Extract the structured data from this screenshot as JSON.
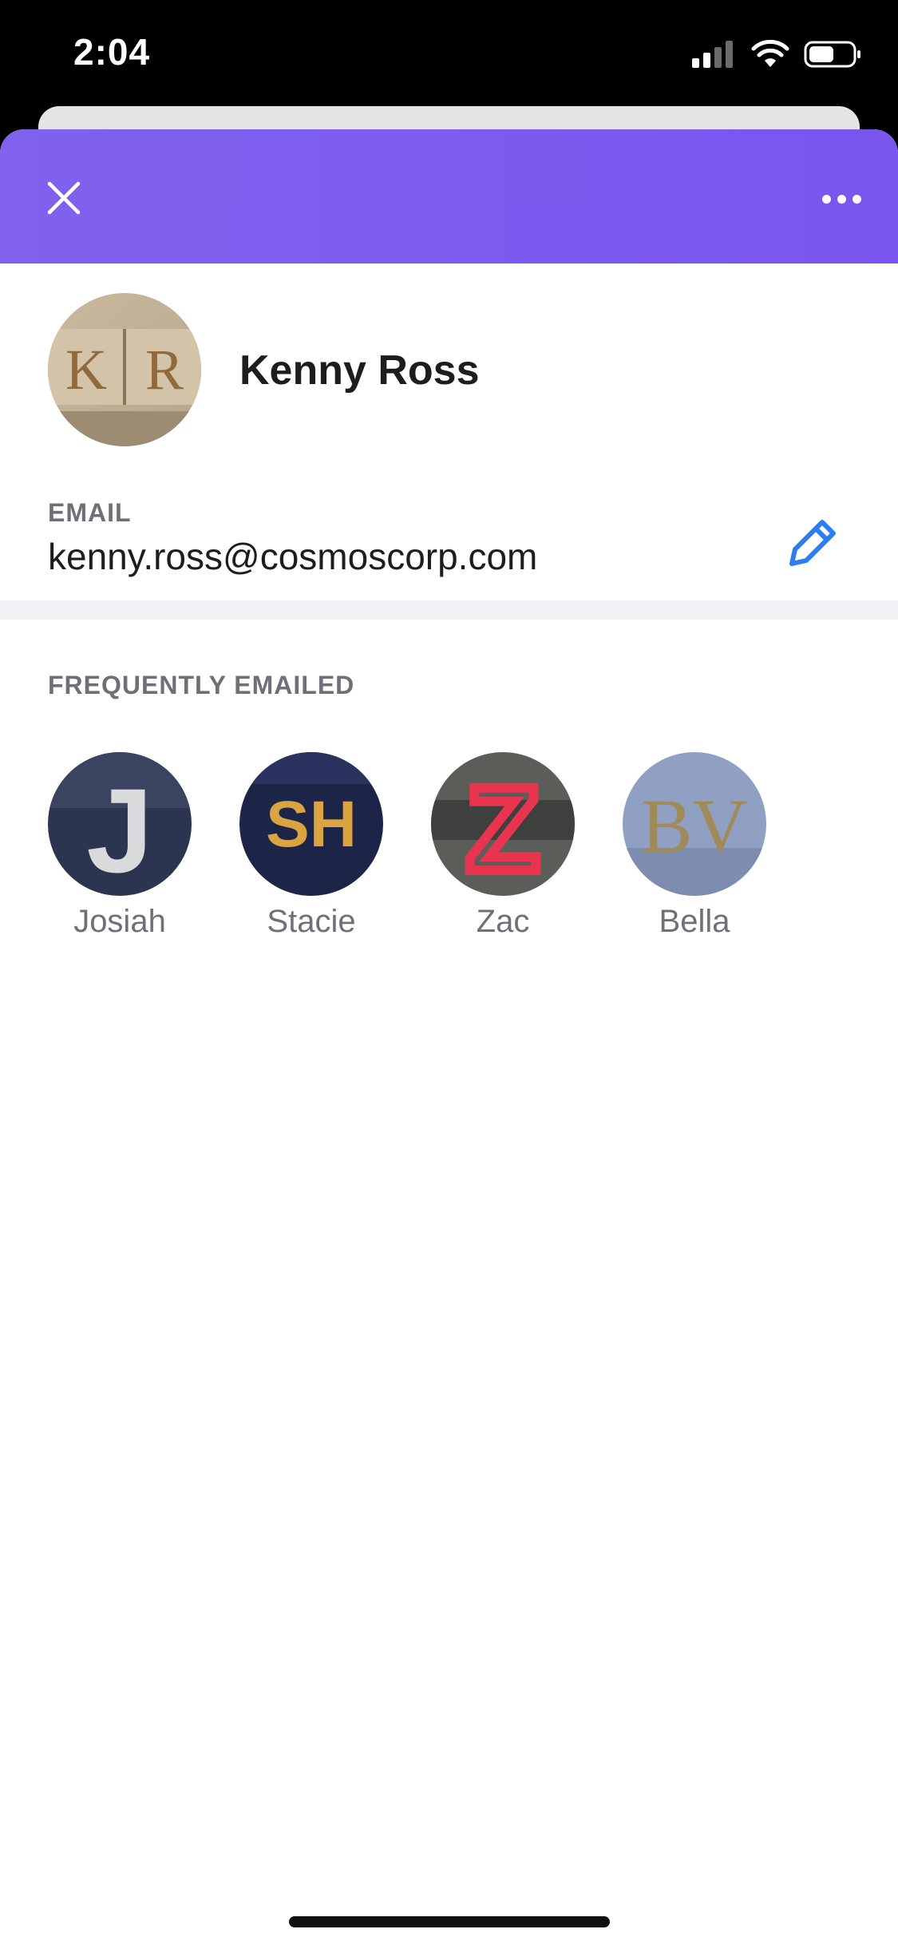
{
  "status_bar": {
    "time": "2:04",
    "icons": [
      "cellular-signal-icon",
      "wifi-icon",
      "battery-icon"
    ]
  },
  "header": {
    "close_icon": "close-icon",
    "more_icon": "more-horizontal-icon",
    "color_start": "#8062ee",
    "color_end": "#7a55ef"
  },
  "profile": {
    "avatar_initials_left": "K",
    "avatar_initials_right": "R",
    "name": "Kenny Ross"
  },
  "email": {
    "label": "EMAIL",
    "value": "kenny.ross@cosmoscorp.com",
    "edit_icon": "pencil-icon",
    "accent": "#2b7df0"
  },
  "frequently_emailed": {
    "label": "FREQUENTLY EMAILED",
    "contacts": [
      {
        "name": "Josiah",
        "avatar_text": "J"
      },
      {
        "name": "Stacie",
        "avatar_text": "SH"
      },
      {
        "name": "Zac",
        "avatar_text": "Z"
      },
      {
        "name": "Bella",
        "avatar_text": "BV"
      }
    ]
  }
}
